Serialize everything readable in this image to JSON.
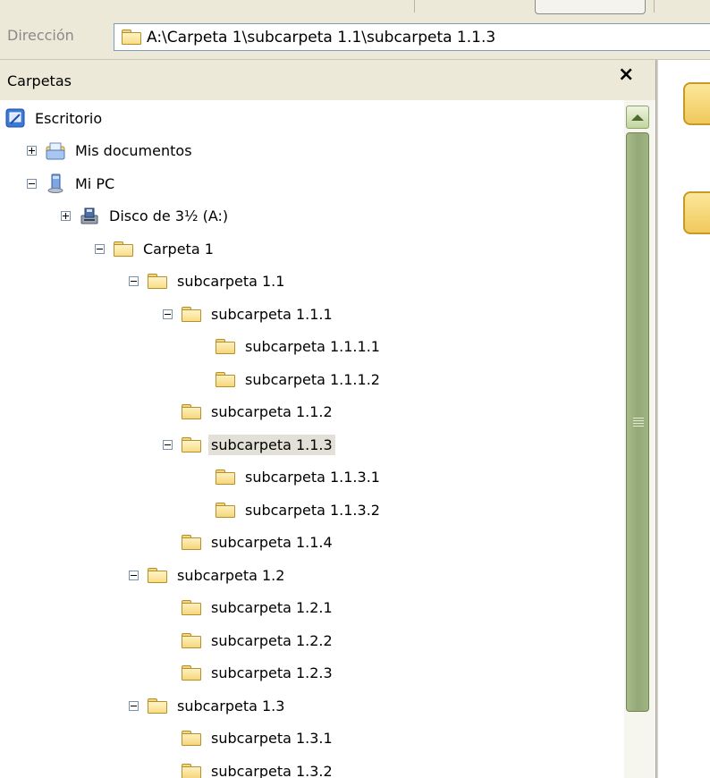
{
  "address": {
    "label": "Dirección",
    "path": "A:\\Carpeta 1\\subcarpeta 1.1\\subcarpeta 1.1.3"
  },
  "pane": {
    "title": "Carpetas",
    "close": "×"
  },
  "tree": [
    {
      "label": "Escritorio",
      "icon": "desktop-icon",
      "expander": "none"
    },
    {
      "label": "Mis documentos",
      "icon": "my-documents-icon",
      "expander": "plus"
    },
    {
      "label": "Mi PC",
      "icon": "my-computer-icon",
      "expander": "minus"
    },
    {
      "label": "Disco de 3½ (A:)",
      "icon": "floppy-drive-icon",
      "expander": "plus"
    },
    {
      "label": "Carpeta 1",
      "icon": "folder-open-icon",
      "expander": "minus"
    },
    {
      "label": "subcarpeta 1.1",
      "icon": "folder-open-icon",
      "expander": "minus"
    },
    {
      "label": "subcarpeta 1.1.1",
      "icon": "folder-open-icon",
      "expander": "minus"
    },
    {
      "label": "subcarpeta 1.1.1.1",
      "icon": "folder-icon",
      "expander": "none"
    },
    {
      "label": "subcarpeta 1.1.1.2",
      "icon": "folder-icon",
      "expander": "none"
    },
    {
      "label": "subcarpeta 1.1.2",
      "icon": "folder-icon",
      "expander": "none"
    },
    {
      "label": "subcarpeta 1.1.3",
      "icon": "folder-open-icon",
      "expander": "minus",
      "selected": true
    },
    {
      "label": "subcarpeta 1.1.3.1",
      "icon": "folder-icon",
      "expander": "none"
    },
    {
      "label": "subcarpeta 1.1.3.2",
      "icon": "folder-icon",
      "expander": "none"
    },
    {
      "label": "subcarpeta 1.1.4",
      "icon": "folder-icon",
      "expander": "none"
    },
    {
      "label": "subcarpeta 1.2",
      "icon": "folder-open-icon",
      "expander": "minus"
    },
    {
      "label": "subcarpeta 1.2.1",
      "icon": "folder-icon",
      "expander": "none"
    },
    {
      "label": "subcarpeta 1.2.2",
      "icon": "folder-icon",
      "expander": "none"
    },
    {
      "label": "subcarpeta 1.2.3",
      "icon": "folder-icon",
      "expander": "none"
    },
    {
      "label": "subcarpeta 1.3",
      "icon": "folder-open-icon",
      "expander": "minus"
    },
    {
      "label": "subcarpeta 1.3.1",
      "icon": "folder-icon",
      "expander": "none"
    },
    {
      "label": "subcarpeta 1.3.2",
      "icon": "folder-icon",
      "expander": "none"
    }
  ],
  "colors": {
    "chrome": "#ece9d8",
    "scroll_thumb": "#94a878",
    "folder": "#f6d67a",
    "selection": "#e3e1d7"
  }
}
